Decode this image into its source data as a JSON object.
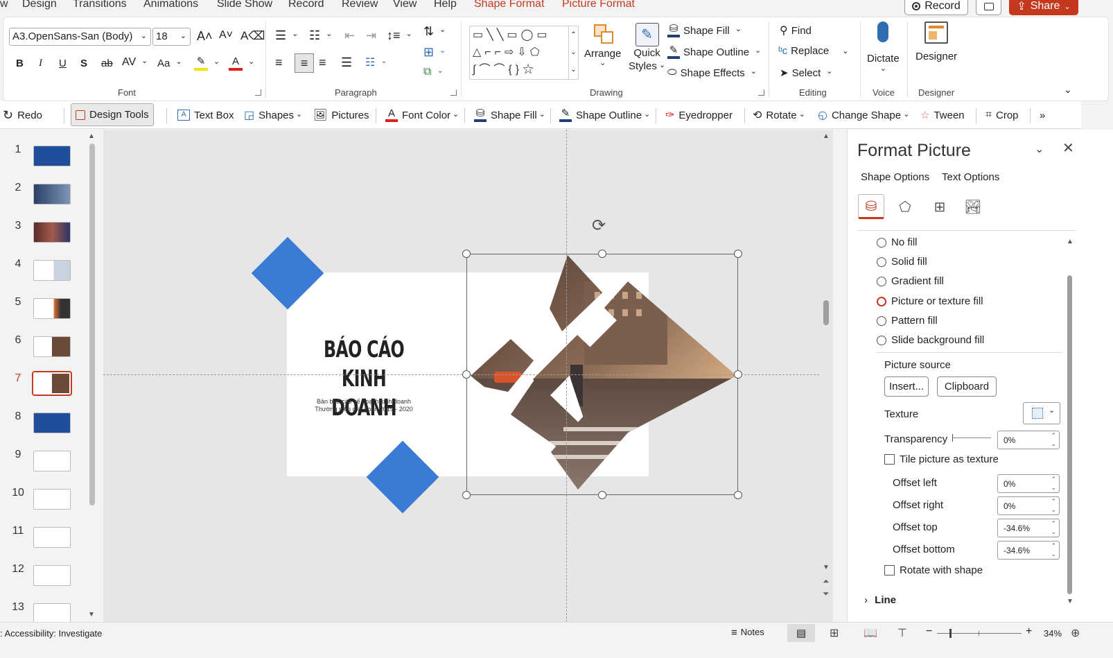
{
  "menu_tabs": [
    "w",
    "Design",
    "Transitions",
    "Animations",
    "Slide Show",
    "Record",
    "Review",
    "View",
    "Help"
  ],
  "context_tabs": [
    "Shape Format",
    "Picture Format"
  ],
  "top_buttons": {
    "record": "Record",
    "share": "Share"
  },
  "ribbon": {
    "font": {
      "name": "A3.OpenSans-San (Body)",
      "size": "18",
      "group_label": "Font"
    },
    "paragraph": {
      "group_label": "Paragraph"
    },
    "drawing": {
      "group_label": "Drawing",
      "arrange": "Arrange",
      "quick_styles": [
        "Quick",
        "Styles"
      ],
      "shape_fill": "Shape Fill",
      "shape_outline": "Shape Outline",
      "shape_effects": "Shape Effects"
    },
    "editing": {
      "group_label": "Editing",
      "find": "Find",
      "replace": "Replace",
      "select": "Select"
    },
    "voice": {
      "group_label": "Voice",
      "dictate": "Dictate"
    },
    "designer": {
      "group_label": "Designer",
      "designer": "Designer"
    }
  },
  "quick_toolbar": {
    "redo": "Redo",
    "design_tools": "Design Tools",
    "text_box": "Text Box",
    "shapes": "Shapes",
    "pictures": "Pictures",
    "font_color": "Font Color",
    "shape_fill": "Shape Fill",
    "shape_outline": "Shape Outline",
    "eyedropper": "Eyedropper",
    "rotate": "Rotate",
    "change_shape": "Change Shape",
    "tween": "Tween",
    "crop": "Crop",
    "more": "»"
  },
  "thumbnails": {
    "numbers": [
      "1",
      "2",
      "3",
      "4",
      "5",
      "6",
      "7",
      "8",
      "9",
      "10",
      "11",
      "12",
      "13"
    ],
    "selected": "7"
  },
  "slide": {
    "title_line1": "BÁO CÁO",
    "title_line2": "KINH DOANH",
    "subtitle_line1": "Bản báo cáo kế hoạch kinh doanh",
    "subtitle_line2": "Thường niên giai đoạn 2019 - 2020"
  },
  "format_panel": {
    "title": "Format Picture",
    "tabs": [
      "Shape Options",
      "Text Options"
    ],
    "fill_options": [
      "No fill",
      "Solid fill",
      "Gradient fill",
      "Picture or texture fill",
      "Pattern fill",
      "Slide background fill"
    ],
    "selected_fill": "Picture or texture fill",
    "picture_source": "Picture source",
    "insert_button": "Insert...",
    "clipboard_button": "Clipboard",
    "texture_label": "Texture",
    "transparency_label": "Transparency",
    "transparency_value": "0%",
    "tile_label": "Tile picture as texture",
    "offsets": [
      {
        "label": "Offset left",
        "value": "0%"
      },
      {
        "label": "Offset right",
        "value": "0%"
      },
      {
        "label": "Offset top",
        "value": "-34.6%"
      },
      {
        "label": "Offset bottom",
        "value": "-34.6%"
      }
    ],
    "rotate_with_shape": "Rotate with shape",
    "line_section": "Line"
  },
  "status": {
    "accessibility": ": Accessibility: Investigate",
    "notes": "Notes",
    "zoom_minus": "−",
    "zoom_plus": "+",
    "zoom_value": "34%"
  },
  "colors": {
    "accent": "#c4391e",
    "diamond_blue": "#3a7bd5"
  }
}
